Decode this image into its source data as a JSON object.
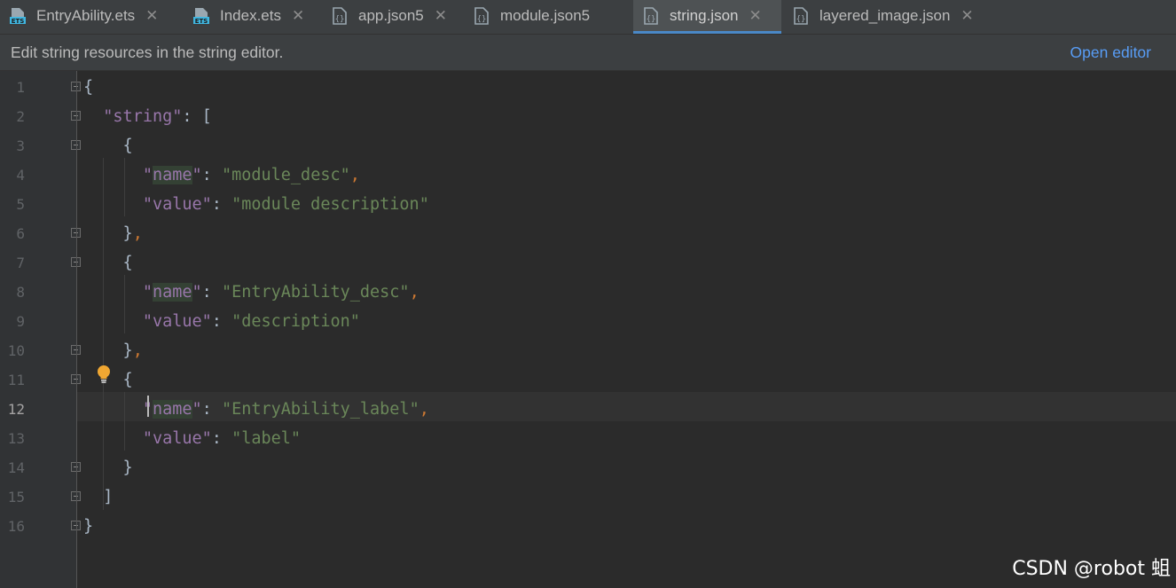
{
  "tabs": [
    {
      "label": "EntryAbility.ets",
      "icon": "ets-file-icon",
      "active": false
    },
    {
      "label": "Index.ets",
      "icon": "ets-file-icon",
      "active": false
    },
    {
      "label": "app.json5",
      "icon": "json-file-icon",
      "active": false
    },
    {
      "label": "module.json5",
      "icon": "json-file-icon",
      "active": false
    },
    {
      "label": "string.json",
      "icon": "json-file-icon",
      "active": true
    },
    {
      "label": "layered_image.json",
      "icon": "json-file-icon",
      "active": false
    }
  ],
  "tab_close_glyph": "✕",
  "notice": {
    "text": "Edit string resources in the string editor.",
    "link": "Open editor"
  },
  "editor": {
    "current_line": 12,
    "line_numbers": [
      "1",
      "2",
      "3",
      "4",
      "5",
      "6",
      "7",
      "8",
      "9",
      "10",
      "11",
      "12",
      "13",
      "14",
      "15",
      "16"
    ],
    "code": [
      "{",
      "  \"string\": [",
      "    {",
      "      \"name\": \"module_desc\",",
      "      \"value\": \"module description\"",
      "    },",
      "    {",
      "      \"name\": \"EntryAbility_desc\",",
      "      \"value\": \"description\"",
      "    },",
      "    {",
      "      \"name\": \"EntryAbility_label\",",
      "      \"value\": \"label\"",
      "    }",
      "  ]",
      "}"
    ]
  },
  "colors": {
    "accent": "#4a88c7",
    "link": "#589df6",
    "json_key": "#9876aa",
    "json_string": "#6a8759",
    "punctuation": "#cc7832"
  },
  "watermark": "CSDN @robot 蛆"
}
